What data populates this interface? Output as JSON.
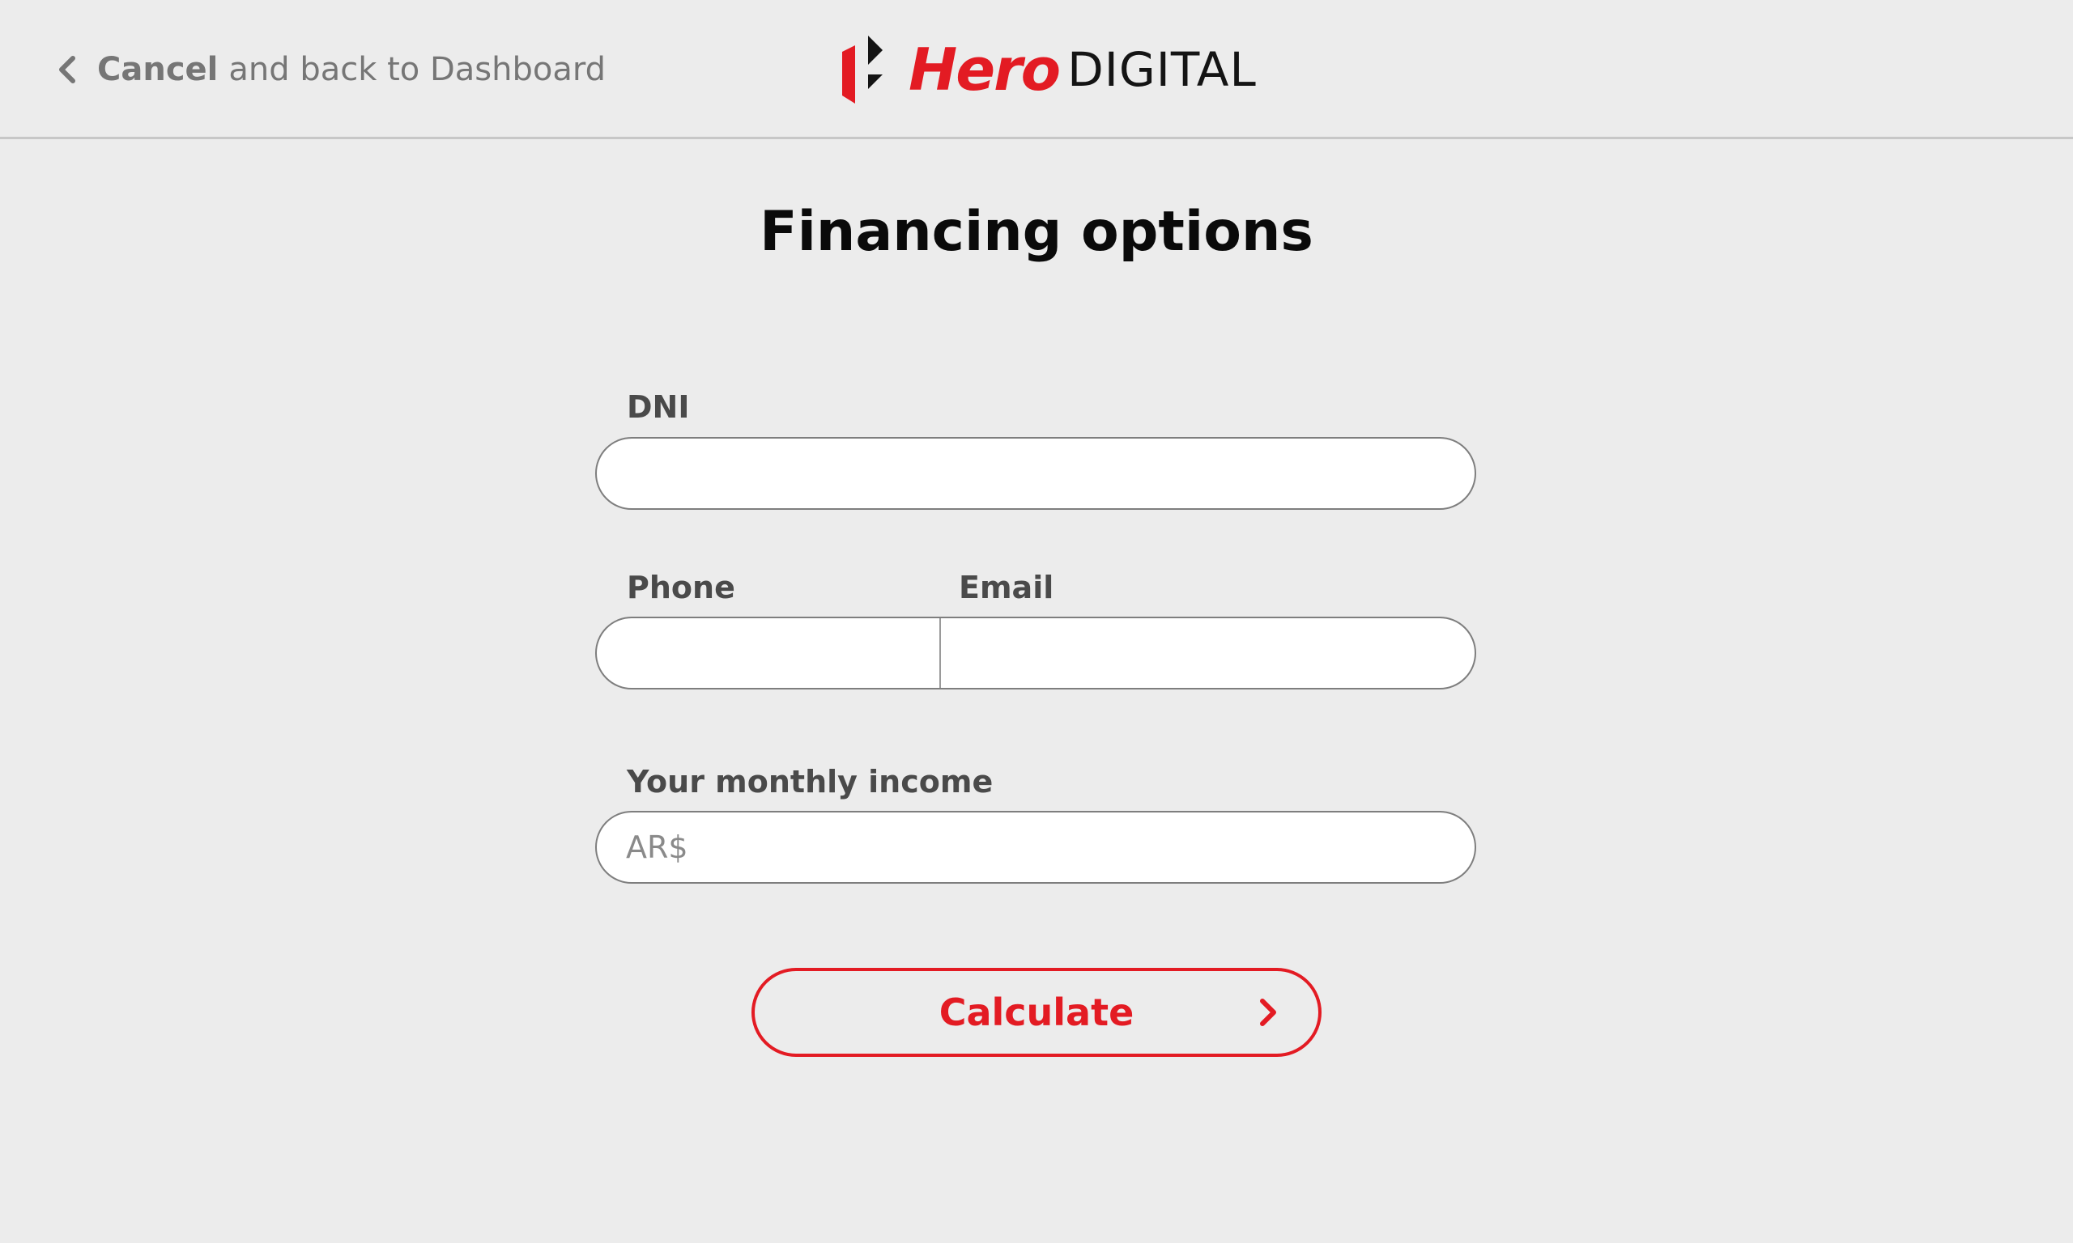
{
  "header": {
    "back_link": {
      "cancel_label": "Cancel",
      "rest_label": "and back to Dashboard",
      "icon": "chevron-left-icon"
    },
    "logo": {
      "brand_word": "Hero",
      "product_word": "DIGITAL",
      "mark_icon": "hero-logo-mark-icon"
    }
  },
  "main": {
    "title": "Financing options",
    "fields": {
      "dni": {
        "label": "DNI",
        "value": "",
        "placeholder": ""
      },
      "phone": {
        "label": "Phone",
        "value": "",
        "placeholder": ""
      },
      "email": {
        "label": "Email",
        "value": "",
        "placeholder": ""
      },
      "income": {
        "label": "Your monthly income",
        "value": "",
        "placeholder": "AR$"
      }
    },
    "calculate_button": {
      "label": "Calculate",
      "icon": "chevron-right-icon"
    }
  },
  "colors": {
    "accent": "#e31b23",
    "background": "#ececec",
    "label_text": "#4a4a4a",
    "muted_text": "#767676"
  }
}
